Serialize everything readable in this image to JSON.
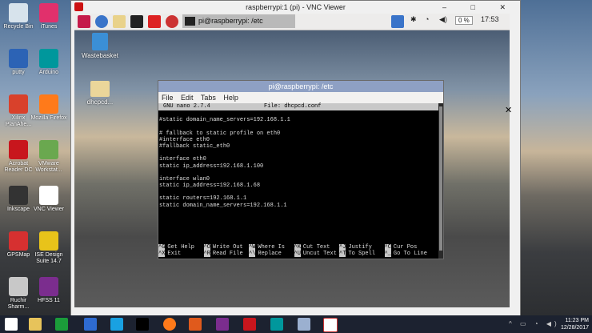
{
  "windows_desktop": {
    "icons": [
      {
        "label": "Recycle Bin",
        "color": "#d7e3ec"
      },
      {
        "label": "iTunes",
        "color": "#e1306c"
      },
      {
        "label": "putty",
        "color": "#2c63b5"
      },
      {
        "label": "Arduino",
        "color": "#00979c"
      },
      {
        "label": "Xilinx PlanAhe...",
        "color": "#d9412b"
      },
      {
        "label": "Mozilla Firefox",
        "color": "#ff7a1a"
      },
      {
        "label": "Acrobat Reader DC",
        "color": "#c8161d"
      },
      {
        "label": "VMware Workstat...",
        "color": "#6aa84f"
      },
      {
        "label": "Inkscape",
        "color": "#333333"
      },
      {
        "label": "VNC Viewer",
        "color": "#ffffff"
      },
      {
        "label": "GPSMap",
        "color": "#d63030"
      },
      {
        "label": "ISE Design Suite 14.7",
        "color": "#e8c31a"
      },
      {
        "label": "Ruchir Sharm...",
        "color": "#c8c8c8"
      },
      {
        "label": "HFSS 11",
        "color": "#7b2d8e"
      }
    ]
  },
  "vnc": {
    "title": "raspberrypi:1 (pi) - VNC Viewer",
    "controls": "– □ ✕"
  },
  "pi": {
    "task_label": "pi@raspberrypi: /etc",
    "tray_value": "0 %",
    "time": "17:53",
    "desktop_icons": [
      {
        "label": "Wastebasket"
      },
      {
        "label": "dhcpcd..."
      }
    ]
  },
  "terminal": {
    "title": "pi@raspberrypi: /etc",
    "menu": [
      "File",
      "Edit",
      "Tabs",
      "Help"
    ],
    "nano_version": "GNU nano 2.7.4",
    "file_name": "File: dhcpcd.conf",
    "lines": [
      "",
      "#static domain_name_servers=192.168.1.1",
      "",
      "# fallback to static profile on eth0",
      "#interface eth0",
      "#fallback static_eth0",
      "",
      "interface eth0",
      "static ip_address=192.168.1.100",
      "",
      "interface wlan0",
      "static ip_address=192.168.1.68",
      "",
      "static routers=192.168.1.1",
      "static domain_name_servers=192.168.1.1"
    ],
    "shortcuts_row1": [
      {
        "key": "^G",
        "label": "Get Help"
      },
      {
        "key": "^O",
        "label": "Write Out"
      },
      {
        "key": "^W",
        "label": "Where Is"
      },
      {
        "key": "^K",
        "label": "Cut Text"
      },
      {
        "key": "^J",
        "label": "Justify"
      },
      {
        "key": "^C",
        "label": "Cur Pos"
      }
    ],
    "shortcuts_row2": [
      {
        "key": "^X",
        "label": "Exit"
      },
      {
        "key": "^R",
        "label": "Read File"
      },
      {
        "key": "^\\",
        "label": "Replace"
      },
      {
        "key": "^U",
        "label": "Uncut Text"
      },
      {
        "key": "^T",
        "label": "To Spell"
      },
      {
        "key": "^_",
        "label": "Go To Line"
      }
    ]
  },
  "taskbar": {
    "time": "11:23 PM",
    "date": "12/28/2017"
  }
}
